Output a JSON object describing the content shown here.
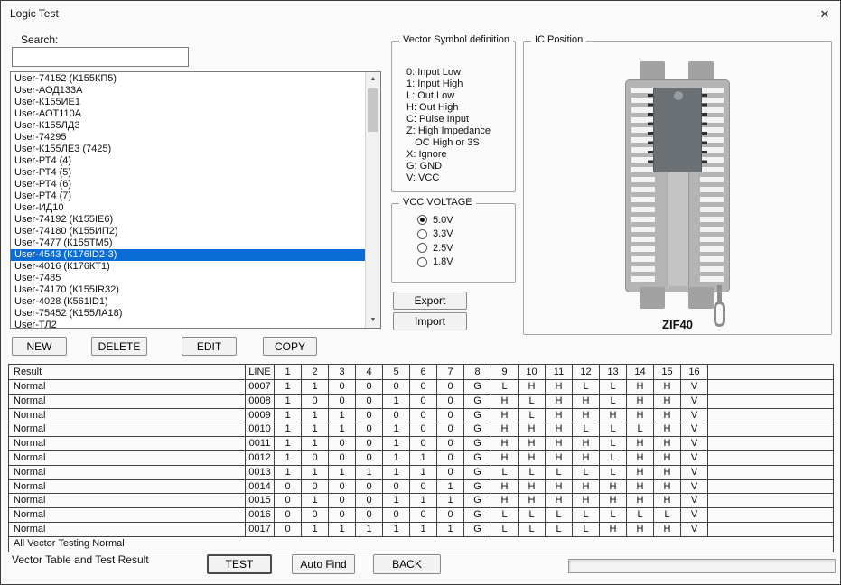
{
  "window": {
    "title": "Logic Test",
    "close_glyph": "✕"
  },
  "search": {
    "label": "Search:",
    "value": ""
  },
  "device_list": {
    "items": [
      "User-74152 (К155КП5)",
      "User-АОД133А",
      "User-К155ИЕ1",
      "User-АОТ110А",
      "User-К155ЛД3",
      "User-74295",
      "User-К155ЛЕ3 (7425)",
      "User-РТ4 (4)",
      "User-РТ4 (5)",
      "User-РТ4 (6)",
      "User-РТ4 (7)",
      "User-ИД10",
      "User-74192 (К155IE6)",
      "User-74180 (К155ИП2)",
      "User-7477 (К155ТМ5)",
      "User-4543 (К176ID2-3)",
      "User-4016 (К176КТ1)",
      "User-7485",
      "User-74170 (К155IR32)",
      "User-4028 (К561ID1)",
      "User-75452 (К155ЛА18)",
      "User-ТЛ2"
    ],
    "selected_index": 15
  },
  "list_buttons": {
    "new": "NEW",
    "delete": "DELETE",
    "edit": "EDIT",
    "copy": "COPY"
  },
  "vector_symbols": {
    "title": "Vector Symbol definition",
    "lines": [
      "0: Input Low",
      "1: Input High",
      "L: Out Low",
      "H: Out High",
      "C: Pulse Input",
      "Z: High Impedance",
      "   OC High or 3S",
      "X: Ignore",
      "G: GND",
      "V: VCC"
    ]
  },
  "vcc": {
    "title": "VCC VOLTAGE",
    "options": [
      "5.0V",
      "3.3V",
      "2.5V",
      "1.8V"
    ],
    "selected": "5.0V"
  },
  "io_buttons": {
    "export": "Export",
    "import": "Import"
  },
  "ic_position": {
    "title": "IC Position",
    "socket_label": "ZIF40"
  },
  "table": {
    "headers": [
      "Result",
      "LINE",
      "1",
      "2",
      "3",
      "4",
      "5",
      "6",
      "7",
      "8",
      "9",
      "10",
      "11",
      "12",
      "13",
      "14",
      "15",
      "16"
    ],
    "rows": [
      {
        "result": "Normal",
        "line": "0007",
        "cells": [
          "1",
          "1",
          "0",
          "0",
          "0",
          "0",
          "0",
          "G",
          "L",
          "H",
          "H",
          "L",
          "L",
          "H",
          "H",
          "V"
        ]
      },
      {
        "result": "Normal",
        "line": "0008",
        "cells": [
          "1",
          "0",
          "0",
          "0",
          "1",
          "0",
          "0",
          "G",
          "H",
          "L",
          "H",
          "H",
          "L",
          "H",
          "H",
          "V"
        ]
      },
      {
        "result": "Normal",
        "line": "0009",
        "cells": [
          "1",
          "1",
          "1",
          "0",
          "0",
          "0",
          "0",
          "G",
          "H",
          "L",
          "H",
          "H",
          "H",
          "H",
          "H",
          "V"
        ]
      },
      {
        "result": "Normal",
        "line": "0010",
        "cells": [
          "1",
          "1",
          "1",
          "0",
          "1",
          "0",
          "0",
          "G",
          "H",
          "H",
          "H",
          "L",
          "L",
          "L",
          "H",
          "V"
        ]
      },
      {
        "result": "Normal",
        "line": "0011",
        "cells": [
          "1",
          "1",
          "0",
          "0",
          "1",
          "0",
          "0",
          "G",
          "H",
          "H",
          "H",
          "H",
          "L",
          "H",
          "H",
          "V"
        ]
      },
      {
        "result": "Normal",
        "line": "0012",
        "cells": [
          "1",
          "0",
          "0",
          "0",
          "1",
          "1",
          "0",
          "G",
          "H",
          "H",
          "H",
          "H",
          "L",
          "H",
          "H",
          "V"
        ]
      },
      {
        "result": "Normal",
        "line": "0013",
        "cells": [
          "1",
          "1",
          "1",
          "1",
          "1",
          "1",
          "0",
          "G",
          "L",
          "L",
          "L",
          "L",
          "L",
          "H",
          "H",
          "V"
        ]
      },
      {
        "result": "Normal",
        "line": "0014",
        "cells": [
          "0",
          "0",
          "0",
          "0",
          "0",
          "0",
          "1",
          "G",
          "H",
          "H",
          "H",
          "H",
          "H",
          "H",
          "H",
          "V"
        ]
      },
      {
        "result": "Normal",
        "line": "0015",
        "cells": [
          "0",
          "1",
          "0",
          "0",
          "1",
          "1",
          "1",
          "G",
          "H",
          "H",
          "H",
          "H",
          "H",
          "H",
          "H",
          "V"
        ]
      },
      {
        "result": "Normal",
        "line": "0016",
        "cells": [
          "0",
          "0",
          "0",
          "0",
          "0",
          "0",
          "0",
          "G",
          "L",
          "L",
          "L",
          "L",
          "L",
          "L",
          "L",
          "V"
        ]
      },
      {
        "result": "Normal",
        "line": "0017",
        "cells": [
          "0",
          "1",
          "1",
          "1",
          "1",
          "1",
          "1",
          "G",
          "L",
          "L",
          "L",
          "L",
          "H",
          "H",
          "H",
          "V"
        ]
      }
    ],
    "summary": "All Vector Testing Normal"
  },
  "footer": {
    "label": "Vector Table and Test Result",
    "test": "TEST",
    "auto_find": "Auto Find",
    "back": "BACK"
  },
  "colors": {
    "selection": "#0a6cd6",
    "grid_line": "#404040"
  },
  "scrollbar": {
    "up_glyph": "▲",
    "down_glyph": "▼"
  }
}
